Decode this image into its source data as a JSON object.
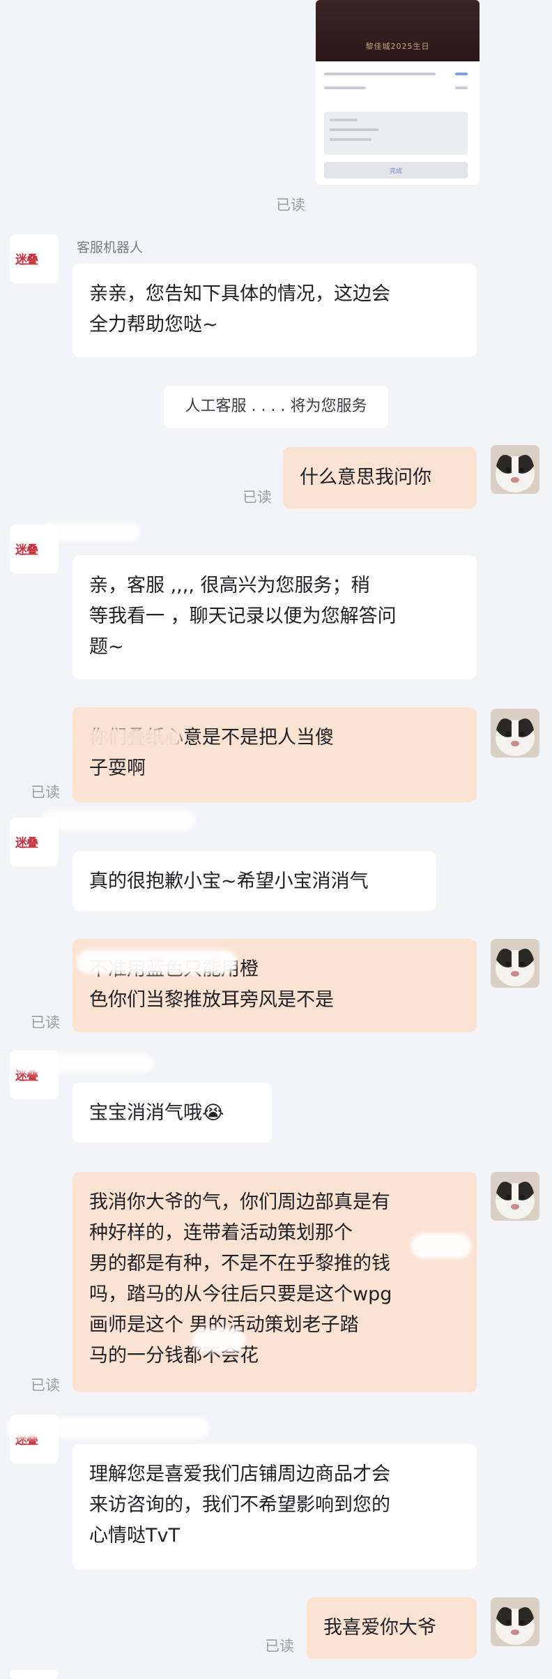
{
  "shared_image": {
    "poster_text": "黎佳城2025生日",
    "button_label": "完成"
  },
  "read_label": "已读",
  "system_notice": "人工客服 . . . . 将为您服务",
  "messages": [
    {
      "side": "left",
      "sender_name": "客服机器人",
      "text": "亲亲，您告知下具体的情况，这边会\n全力帮助您哒~"
    },
    {
      "side": "right",
      "text": "什么意思我问你"
    },
    {
      "side": "left",
      "sender_name": "",
      "text": "亲，客服 ,,,, 很高兴为您服务；稍\n等我看一 ，聊天记录以便为您解答问\n题~"
    },
    {
      "side": "right",
      "text": "      你们叠纸心意是不是把人当傻\n子耍啊"
    },
    {
      "side": "left",
      "sender_name": "",
      "text": "真的很抱歉小宝~希望小宝消消气"
    },
    {
      "side": "right",
      "text": "              不准用蓝色只能用橙\n色你们当黎推放耳旁风是不是"
    },
    {
      "side": "left",
      "sender_name": "",
      "text": "宝宝消消气哦😭"
    },
    {
      "side": "right",
      "text": "我消你大爷的气，你们周边部真是有\n种好样的，连带着活动策划那个\n男的都是有种，不是不在乎黎推的钱\n吗，踏马的从今往后只要是这个wpg\n画师是这个    男的活动策划老子踏\n马的一分钱都不会花"
    },
    {
      "side": "left",
      "sender_name": "",
      "text": "理解您是喜爱我们店铺周边商品才会\n来访咨询的，我们不希望影响到您的\n心情哒TvT"
    },
    {
      "side": "right",
      "text": "我喜爱你大爷"
    }
  ],
  "icons": {
    "bot_avatar": "store-logo-icon",
    "user_avatar": "cat-avatar-icon"
  }
}
